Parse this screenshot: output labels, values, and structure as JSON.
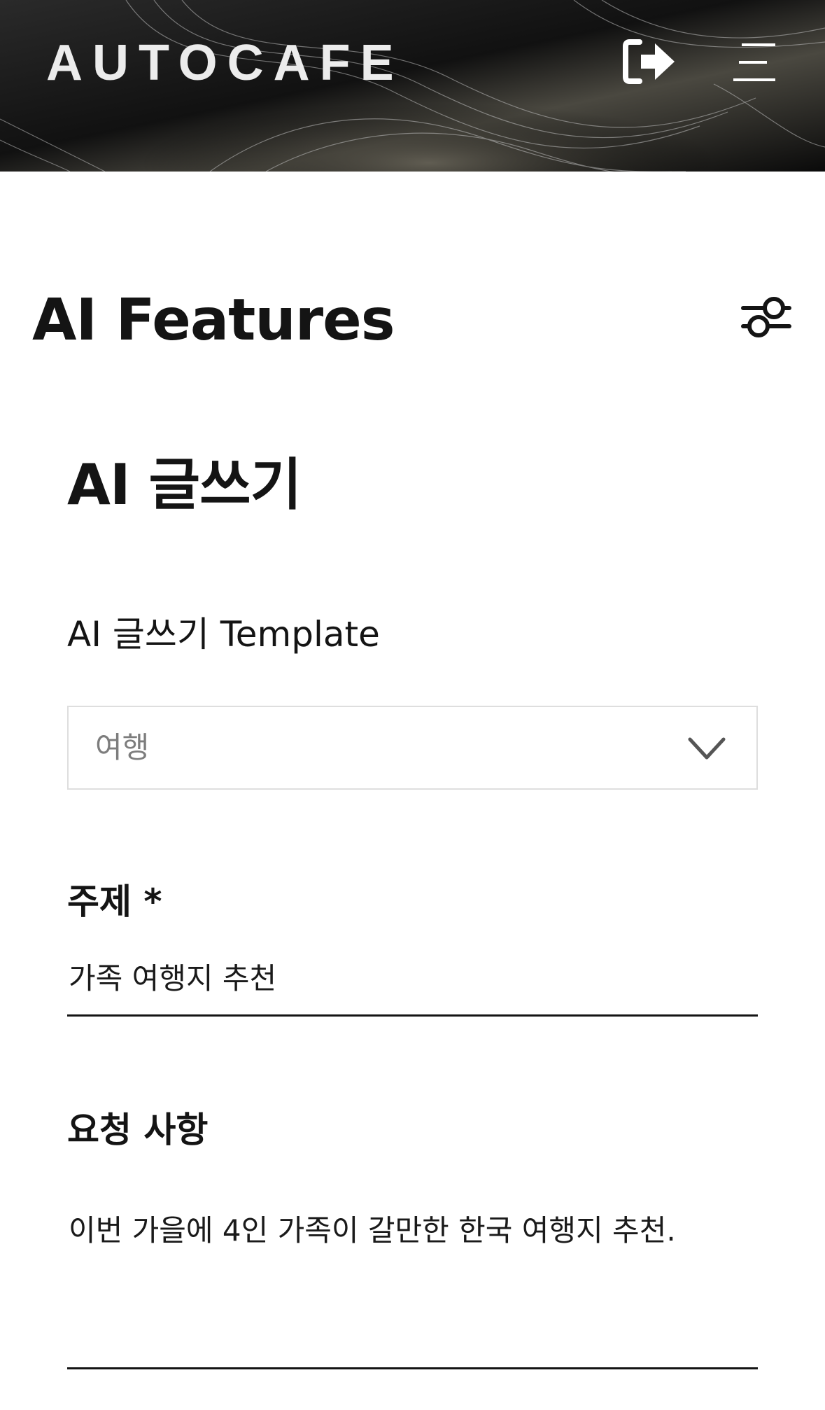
{
  "header": {
    "logo_text": "AUTOCAFE",
    "logout_icon": "logout-icon",
    "menu_icon": "hamburger-menu-icon",
    "background_color": "#0d0d0d"
  },
  "page": {
    "title": "AI Features",
    "filter_icon": "sliders-icon"
  },
  "section": {
    "title": "AI 글쓰기"
  },
  "form": {
    "template_label": "AI 글쓰기 Template",
    "template_selected": "여행",
    "template_chevron_icon": "chevron-down-icon",
    "topic_label": "주제 *",
    "topic_value": "가족 여행지 추천",
    "request_label": "요청 사항",
    "request_value": "이번 가을에 4인 가족이 갈만한 한국 여행지 추천."
  }
}
